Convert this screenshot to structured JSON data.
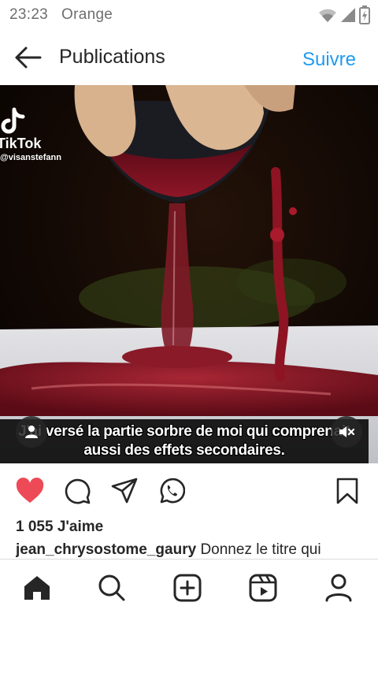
{
  "status_bar": {
    "time": "23:23",
    "carrier": "Orange",
    "icons": [
      "wifi-icon",
      "signal-icon",
      "battery-charging-icon"
    ]
  },
  "header": {
    "title": "Publications",
    "follow_label": "Suivre",
    "back_icon": "arrow-left-icon"
  },
  "post": {
    "watermark": {
      "app": "TikTok",
      "handle": "@visanstefann"
    },
    "video_caption": {
      "line1": "J'ai versé la partie sorbre de moi qui comprenait",
      "line2": "aussi des effets secondaires."
    },
    "liked": true,
    "likes_text": "1 055 J'aime",
    "author": "jean_chrysostome_gaury",
    "caption": "Donnez le titre qui"
  },
  "actions": [
    "heart-icon",
    "comment-icon",
    "share-icon",
    "whatsapp-icon",
    "bookmark-icon"
  ],
  "bottom_nav": [
    "home-icon",
    "search-icon",
    "create-icon",
    "reels-icon",
    "profile-icon"
  ],
  "colors": {
    "accent": "#1e9bf0",
    "like": "#ed4956",
    "text": "#262626"
  }
}
